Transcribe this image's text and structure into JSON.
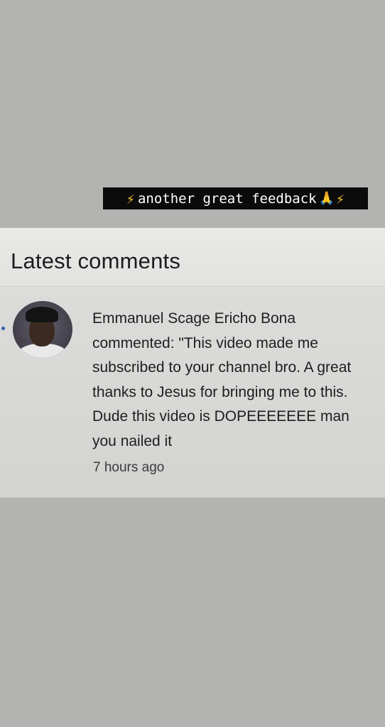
{
  "story": {
    "caption": "another great feedback",
    "caption_icons": {
      "left": "lightning-bolt-icon",
      "right_pray": "praying-hands-icon",
      "right_bolt": "lightning-bolt-icon"
    },
    "colors": {
      "background": "#b3b3b1",
      "caption_bg": "#0b0b0b",
      "caption_text": "#ffffff",
      "bolt": "#f6c431"
    }
  },
  "screenshot": {
    "section_title": "Latest comments",
    "comment": {
      "avatar": "user-avatar-photo",
      "text": "Emmanuel Scage Ericho Bona commented: \"This video made me subscribed to your channel bro. A great thanks to Jesus for bringing me to this. Dude this video is DOPEEEEEEE man you nailed it",
      "time": "7 hours ago"
    }
  }
}
